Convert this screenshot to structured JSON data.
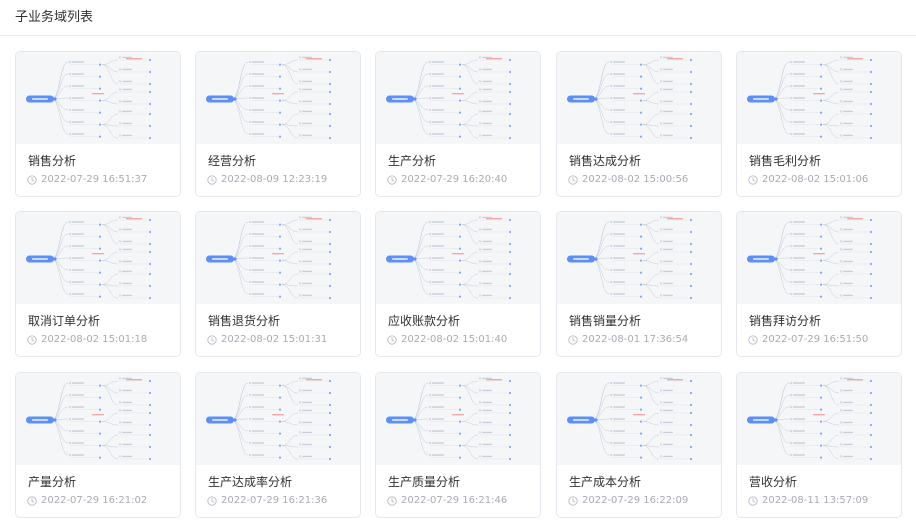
{
  "page": {
    "title": "子业务域列表"
  },
  "colors": {
    "accent": "#5b8ff9",
    "card_border": "#e4e7ed",
    "thumb_bg": "#f5f6f8",
    "muted_text": "#a8abb2"
  },
  "cards": [
    {
      "title": "销售分析",
      "time": "2022-07-29 16:51:37"
    },
    {
      "title": "经营分析",
      "time": "2022-08-09 12:23:19"
    },
    {
      "title": "生产分析",
      "time": "2022-07-29 16:20:40"
    },
    {
      "title": "销售达成分析",
      "time": "2022-08-02 15:00:56"
    },
    {
      "title": "销售毛利分析",
      "time": "2022-08-02 15:01:06"
    },
    {
      "title": "取消订单分析",
      "time": "2022-08-02 15:01:18"
    },
    {
      "title": "销售退货分析",
      "time": "2022-08-02 15:01:31"
    },
    {
      "title": "应收账款分析",
      "time": "2022-08-02 15:01:40"
    },
    {
      "title": "销售销量分析",
      "time": "2022-08-01 17:36:54"
    },
    {
      "title": "销售拜访分析",
      "time": "2022-07-29 16:51:50"
    },
    {
      "title": "产量分析",
      "time": "2022-07-29 16:21:02"
    },
    {
      "title": "生产达成率分析",
      "time": "2022-07-29 16:21:36"
    },
    {
      "title": "生产质量分析",
      "time": "2022-07-29 16:21:46"
    },
    {
      "title": "生产成本分析",
      "time": "2022-07-29 16:22:09"
    },
    {
      "title": "营收分析",
      "time": "2022-08-11 13:57:09"
    }
  ]
}
